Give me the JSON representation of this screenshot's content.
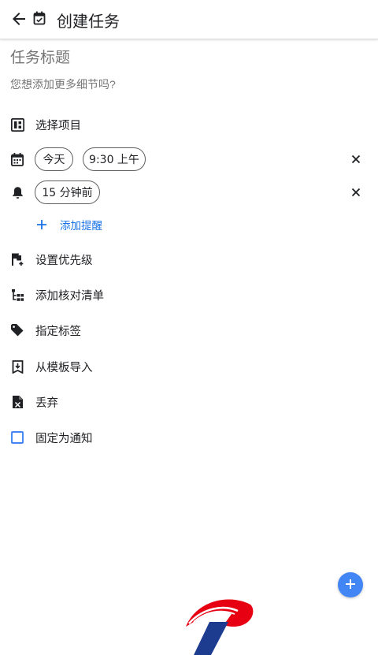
{
  "header": {
    "title": "创建任务",
    "back_icon": "arrow-back-icon",
    "task_type_icon": "calendar-check-icon"
  },
  "task": {
    "title_placeholder": "任务标题",
    "description_placeholder": "您想添加更多细节吗?"
  },
  "rows": {
    "project": {
      "label": "选择项目",
      "icon": "dashboard-icon"
    },
    "schedule": {
      "icon": "calendar-icon",
      "date_chip": "今天",
      "time_chip": "9:30 上午",
      "clear_icon": "close-icon"
    },
    "reminder": {
      "icon": "bell-icon",
      "chip": "15 分钟前",
      "clear_icon": "close-icon"
    },
    "add_reminder": {
      "label": "添加提醒",
      "icon": "plus-icon"
    },
    "priority": {
      "label": "设置优先级",
      "icon": "flag-add-icon"
    },
    "checklist": {
      "label": "添加核对清单",
      "icon": "checklist-tree-icon"
    },
    "tags": {
      "label": "指定标签",
      "icon": "tag-icon"
    },
    "template": {
      "label": "从模板导入",
      "icon": "bookmark-import-icon"
    },
    "discard": {
      "label": "丢弃",
      "icon": "file-delete-icon"
    },
    "pin": {
      "label": "固定为通知",
      "icon": "checkbox-icon"
    }
  },
  "fab": {
    "icon": "plus-icon"
  },
  "colors": {
    "accent": "#4285f4",
    "link": "#1a73e8",
    "text": "#202124",
    "muted": "#8a8a8a",
    "logo_red": "#e60012",
    "logo_blue": "#1d3b8f"
  }
}
